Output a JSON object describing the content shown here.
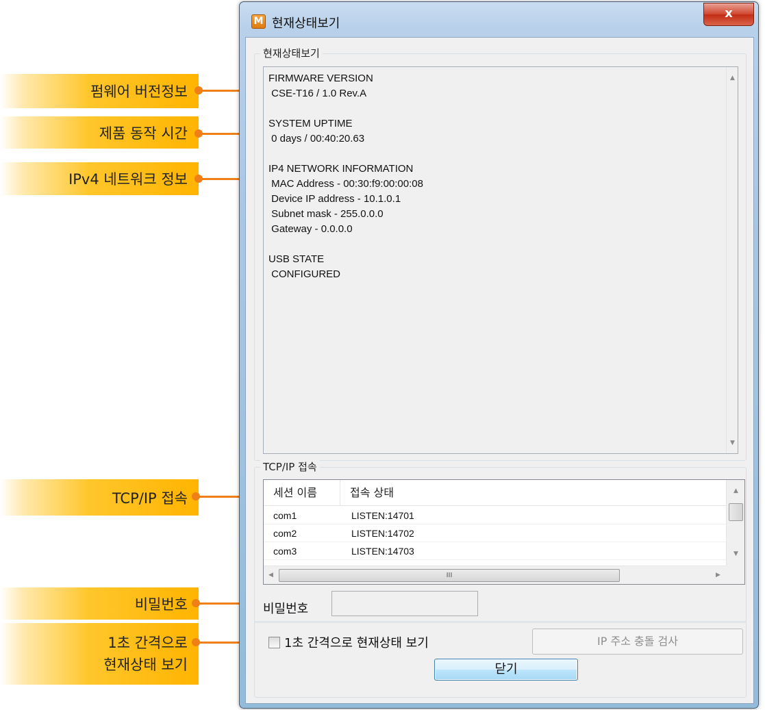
{
  "window": {
    "title": "현재상태보기",
    "app_icon": "M",
    "close_label": "x"
  },
  "status_group": {
    "title": "현재상태보기",
    "text": "FIRMWARE VERSION\n CSE-T16 / 1.0 Rev.A\n\nSYSTEM UPTIME\n 0 days / 00:40:20.63\n\nIP4 NETWORK INFORMATION\n MAC Address - 00:30:f9:00:00:08\n Device IP address - 10.1.0.1\n Subnet mask - 255.0.0.0\n Gateway - 0.0.0.0\n\nUSB STATE\n CONFIGURED"
  },
  "tcp_group": {
    "title": "TCP/IP 접속",
    "columns": [
      "세션 이름",
      "접속 상태"
    ],
    "rows": [
      [
        "com1",
        "LISTEN:14701"
      ],
      [
        "com2",
        "LISTEN:14702"
      ],
      [
        "com3",
        "LISTEN:14703"
      ]
    ],
    "hscroll_grip": "III"
  },
  "password": {
    "label": "비밀번호",
    "value": ""
  },
  "auto_refresh": {
    "label": "1초 간격으로 현재상태 보기",
    "checked": false
  },
  "ip_check_button": "IP 주소 충돌 검사",
  "close_button": "닫기",
  "callouts": {
    "firmware": "펌웨어 버전정보",
    "uptime": "제품 동작 시간",
    "network": "IPv4 네트워크 정보",
    "tcp": "TCP/IP 접속",
    "password": "비밀번호",
    "refresh_line1": "1초 간격으로",
    "refresh_line2": "현재상태 보기"
  },
  "colors": {
    "callout_accent": "#ffb400",
    "connector": "#f07f16"
  }
}
